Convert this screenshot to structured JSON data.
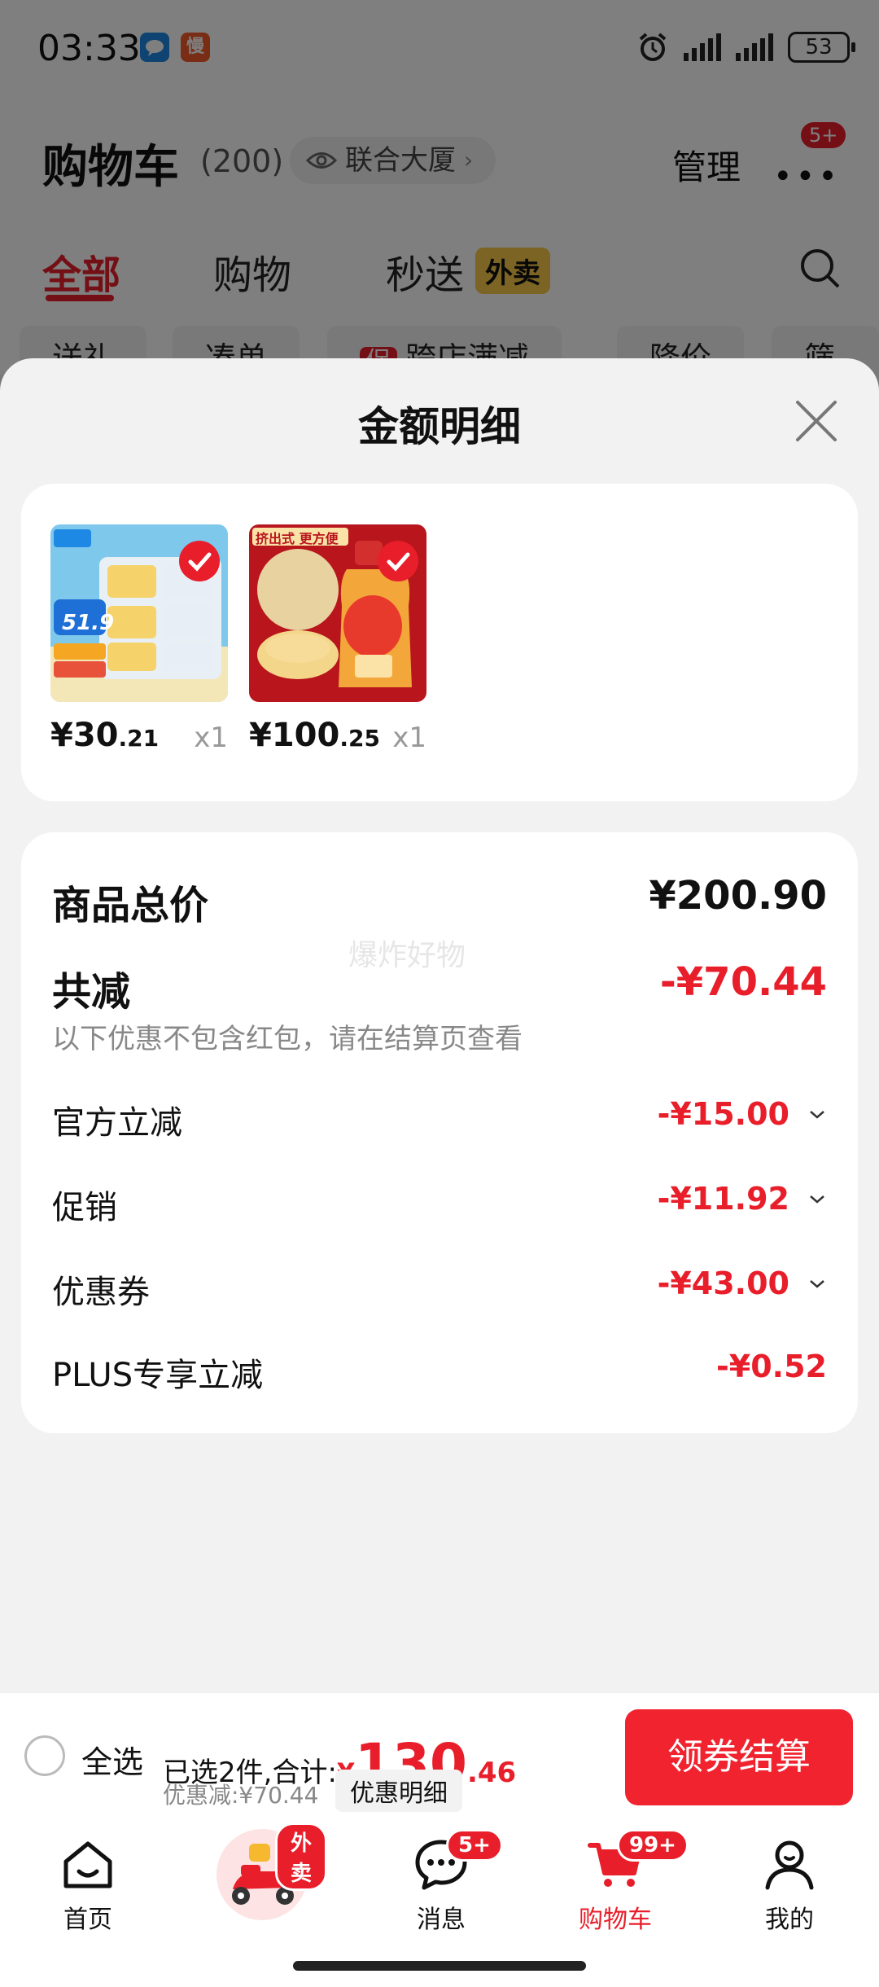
{
  "status_bar": {
    "time": "03:33",
    "battery": "53",
    "app_icon_2": "慢"
  },
  "header": {
    "title": "购物车",
    "count": "(200)",
    "location": "联合大厦",
    "manage": "管理",
    "more_badge": "5+"
  },
  "tabs": [
    {
      "label": "全部",
      "active": true
    },
    {
      "label": "购物",
      "active": false
    },
    {
      "label": "秒送",
      "active": false
    }
  ],
  "tab_badge": "外卖",
  "chips": [
    "送礼",
    "凑单",
    "跨店满减",
    "降价",
    "筛选"
  ],
  "chip_icon_text": "促",
  "sheet": {
    "title": "金额明细",
    "items": [
      {
        "price_main": "¥30",
        "price_decimal": ".21",
        "qty": "x1",
        "tag": "51.9"
      },
      {
        "price_main": "¥100",
        "price_decimal": ".25",
        "qty": "x1",
        "tag": "挤出式 更方便"
      }
    ],
    "summary": {
      "total_label": "商品总价",
      "total_value": "¥200.90",
      "watermark": "爆炸好物",
      "reduce_label": "共减",
      "reduce_value": "-¥70.44",
      "note": "以下优惠不包含红包，请在结算页查看",
      "rows": [
        {
          "label": "官方立减",
          "value": "-¥15.00",
          "expandable": true
        },
        {
          "label": "促销",
          "value": "-¥11.92",
          "expandable": true
        },
        {
          "label": "优惠券",
          "value": "-¥43.00",
          "expandable": true
        },
        {
          "label": "PLUS专享立减",
          "value": "-¥0.52",
          "expandable": false
        }
      ]
    }
  },
  "checkout": {
    "select_all": "全选",
    "selected_text": "已选2件,合计:",
    "total_yen": "¥",
    "total_int": "130",
    "total_dec": ".46",
    "discount": "优惠减:¥70.44",
    "detail_button": "优惠明细",
    "checkout_button": "领券结算"
  },
  "nav": [
    {
      "label": "首页",
      "badge": ""
    },
    {
      "label": "",
      "badge": "外卖"
    },
    {
      "label": "消息",
      "badge": "5+"
    },
    {
      "label": "购物车",
      "badge": "99+",
      "active": true
    },
    {
      "label": "我的",
      "badge": ""
    }
  ],
  "colors": {
    "accent": "#e81e2a",
    "background": "#f2f2f2"
  }
}
